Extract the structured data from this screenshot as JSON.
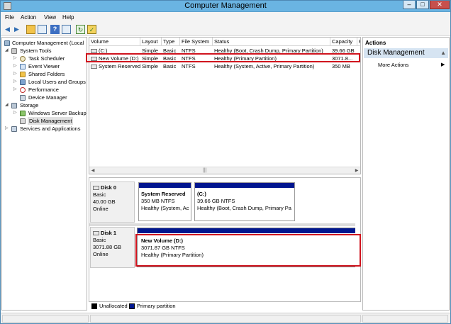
{
  "window": {
    "title": "Computer Management",
    "controls": {
      "minimize": "–",
      "maximize": "□",
      "close": "✕"
    }
  },
  "menu": [
    "File",
    "Action",
    "View",
    "Help"
  ],
  "toolbar_icons": [
    "back-icon",
    "forward-icon",
    "up-folder-icon",
    "show-hide-tree-icon",
    "help-icon",
    "properties-icon",
    "refresh-icon",
    "export-icon"
  ],
  "tree": {
    "root": "Computer Management (Local",
    "system_tools": "System Tools",
    "task_scheduler": "Task Scheduler",
    "event_viewer": "Event Viewer",
    "shared_folders": "Shared Folders",
    "local_users": "Local Users and Groups",
    "performance": "Performance",
    "device_manager": "Device Manager",
    "storage": "Storage",
    "wsb": "Windows Server Backup",
    "disk_management": "Disk Management",
    "services": "Services and Applications"
  },
  "volumes": {
    "columns": [
      "Volume",
      "Layout",
      "Type",
      "File System",
      "Status",
      "Capacity",
      "F"
    ],
    "rows": [
      {
        "volume": "(C:)",
        "layout": "Simple",
        "type": "Basic",
        "fs": "NTFS",
        "status": "Healthy (Boot, Crash Dump, Primary Partition)",
        "capacity": "39.66 GB"
      },
      {
        "volume": "New Volume (D:)",
        "layout": "Simple",
        "type": "Basic",
        "fs": "NTFS",
        "status": "Healthy (Primary Partition)",
        "capacity": "3071.8..."
      },
      {
        "volume": "System Reserved",
        "layout": "Simple",
        "type": "Basic",
        "fs": "NTFS",
        "status": "Healthy (System, Active, Primary Partition)",
        "capacity": "350 MB"
      }
    ]
  },
  "disks": [
    {
      "name": "Disk 0",
      "type": "Basic",
      "size": "40.00 GB",
      "status": "Online",
      "partitions": [
        {
          "name": "System Reserved",
          "info": "350 MB NTFS",
          "status": "Healthy (System, Ac"
        },
        {
          "name": "(C:)",
          "info": "39.66 GB NTFS",
          "status": "Healthy (Boot, Crash Dump, Primary Pa"
        }
      ]
    },
    {
      "name": "Disk 1",
      "type": "Basic",
      "size": "3071.88 GB",
      "status": "Online",
      "partitions": [
        {
          "name": "New Volume  (D:)",
          "info": "3071.87 GB NTFS",
          "status": "Healthy (Primary Partition)"
        }
      ]
    }
  ],
  "legend": [
    {
      "label": "Unallocated",
      "color": "#000000"
    },
    {
      "label": "Primary partition",
      "color": "#00168f"
    }
  ],
  "actions": {
    "header": "Actions",
    "section": "Disk Management",
    "items": [
      "More Actions"
    ]
  },
  "colors": {
    "accent": "#d0141e",
    "titlebar": "#6ab4e2",
    "partition_bar": "#00168f"
  }
}
